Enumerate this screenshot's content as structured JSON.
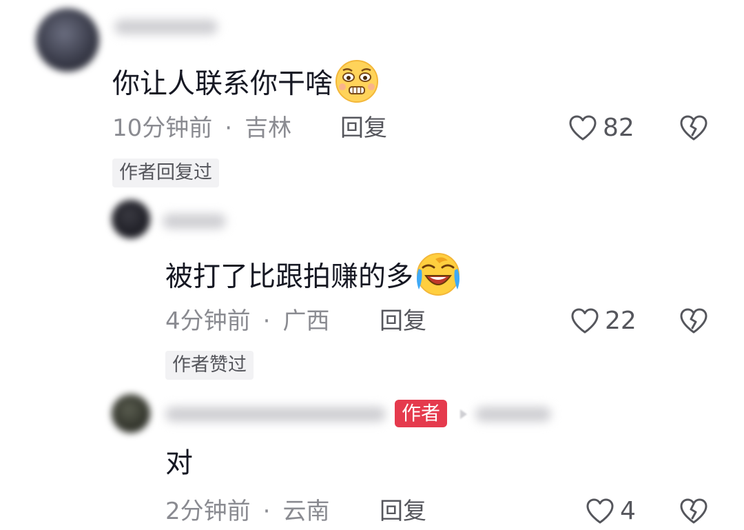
{
  "comments": [
    {
      "text": "你让人联系你干啥",
      "emoji": "nervous-face-emoji",
      "time": "10分钟前",
      "separator": "·",
      "location": "吉林",
      "reply_label": "回复",
      "likes": "82",
      "tag": "作者回复过"
    },
    {
      "text": "被打了比跟拍赚的多",
      "emoji": "crying-laughing-emoji",
      "time": "4分钟前",
      "separator": "·",
      "location": "广西",
      "reply_label": "回复",
      "likes": "22",
      "tag": "作者赞过"
    },
    {
      "text": "对",
      "time": "2分钟前",
      "separator": "·",
      "location": "云南",
      "reply_label": "回复",
      "likes": "4",
      "author_badge": "作者"
    }
  ],
  "icons": {
    "like": "heart-outline-icon",
    "dislike": "broken-heart-icon"
  },
  "colors": {
    "author_badge_bg": "#e53a4d",
    "meta_text": "#8a8b91",
    "tag_bg": "#f2f2f4"
  }
}
